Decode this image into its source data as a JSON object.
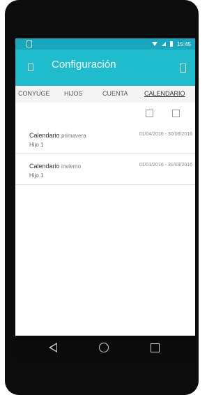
{
  "toolbar": {
    "title": "Configuración"
  },
  "statusbar": {
    "time": "15:45"
  },
  "tabs": [
    "CONYUGE",
    "HIJOS",
    "CUENTA",
    "CALENDARIO"
  ],
  "active_tab": "CALENDARIO",
  "calendars": [
    {
      "label": "Calendario",
      "season": "primavera",
      "child": "Hijo 1",
      "dates": "01/04/2016 - 30/06/2016"
    },
    {
      "label": "Calendario",
      "season": "invierno",
      "child": "Hijo 1",
      "dates": "01/01/2016 - 31/03/2016"
    }
  ],
  "icons": {
    "status_left": "notification-icon",
    "toolbar_left": "menu-icon",
    "toolbar_right": "overflow-icon",
    "action_1": "add-icon",
    "action_2": "edit-icon",
    "nav_back": "back-icon",
    "nav_home": "home-icon",
    "nav_recent": "recent-apps-icon"
  },
  "colors": {
    "status_bar": "#1aa7bd",
    "toolbar": "#1ebccd",
    "phone_frame": "#0c0c0c"
  }
}
